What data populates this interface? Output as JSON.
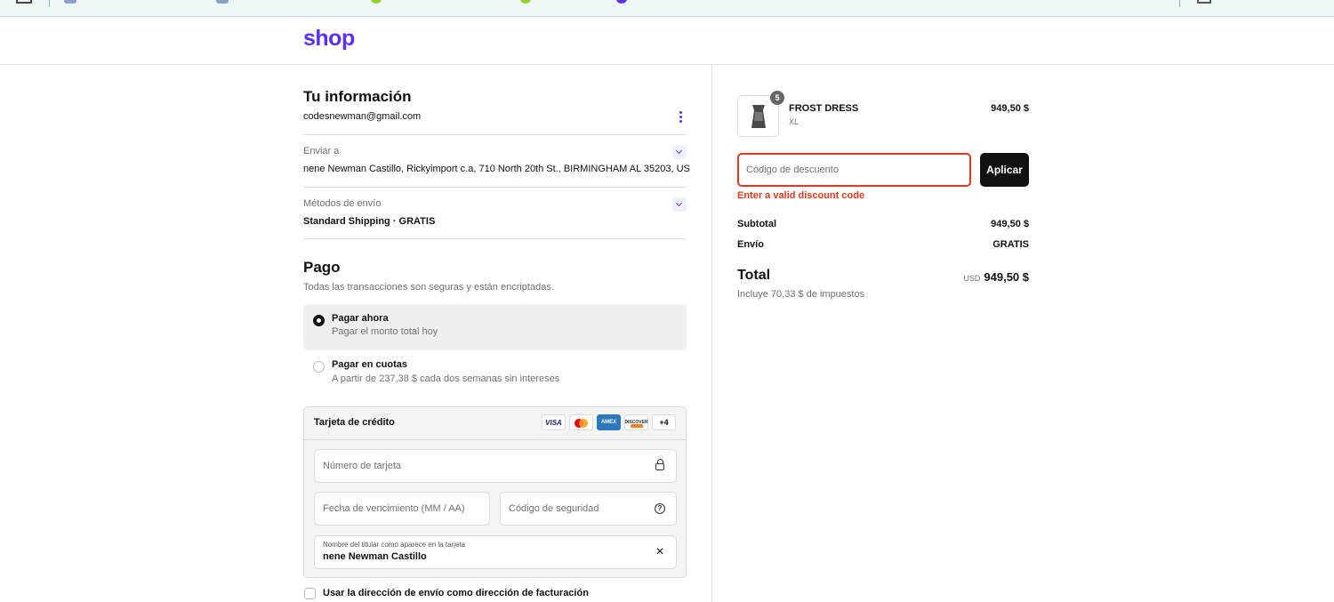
{
  "brand": {
    "logo": "shop",
    "color": "#5a31f4"
  },
  "info": {
    "title": "Tu información",
    "email": "codesnewman@gmail.com",
    "ship_label": "Enviar a",
    "ship_value": "nene Newman Castillo, Rickyimport c.a, 710 North 20th St., BIRMINGHAM AL 35203, US",
    "method_label": "Métodos de envío",
    "method_value": "Standard Shipping · GRATIS"
  },
  "payment": {
    "title": "Pago",
    "subtitle": "Todas las transacciones son seguras y están encriptadas.",
    "options": [
      {
        "label": "Pagar ahora",
        "desc": "Pagar el monto total hoy",
        "selected": true
      },
      {
        "label": "Pagar en cuotas",
        "desc": "A partir de 237,38 $ cada dos semanas sin intereses",
        "selected": false
      }
    ],
    "card": {
      "title": "Tarjeta de crédito",
      "brands": [
        "VISA",
        "Mastercard",
        "AMEX",
        "DISCOVER",
        "+4"
      ],
      "number_placeholder": "Número de tarjeta",
      "expiry_placeholder": "Fecha de vencimiento (MM / AA)",
      "cvc_placeholder": "Código de seguridad",
      "name_label": "Nombre del titular como aparece en la tarjeta",
      "name_value": "nene Newman Castillo"
    },
    "billing_checkbox": "Usar la dirección de envío como dirección de facturación"
  },
  "summary": {
    "item": {
      "name": "FROST DRESS",
      "variant": "XL",
      "price": "949,50 $",
      "qty": "5"
    },
    "discount_placeholder": "Código de descuento",
    "apply_label": "Aplicar",
    "error": "Enter a valid discount code",
    "subtotal_label": "Subtotal",
    "subtotal_value": "949,50 $",
    "shipping_label": "Envío",
    "shipping_value": "GRATIS",
    "total_label": "Total",
    "currency": "USD",
    "total_value": "949,50 $",
    "taxes_note": "Incluye 70,33 $ de impuestos"
  },
  "icons": {
    "more": "more-vertical-icon",
    "chevron": "chevron-down-icon",
    "lock": "lock-icon",
    "help": "help-circle-icon",
    "clear": "close-icon"
  }
}
